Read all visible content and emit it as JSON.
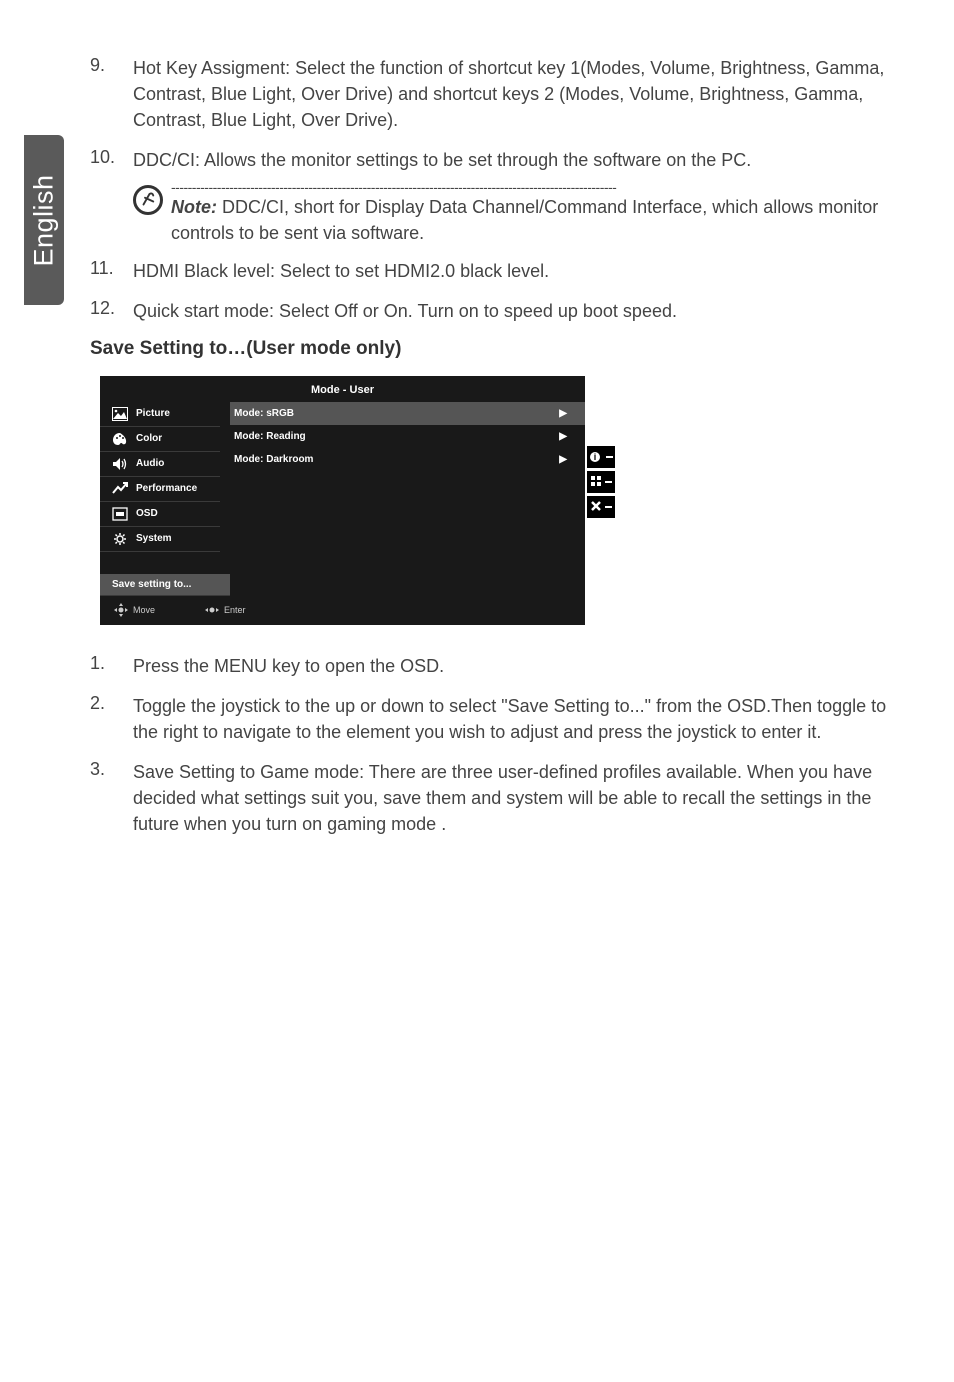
{
  "sideTab": "English",
  "items": {
    "n9": {
      "num": "9.",
      "text": "Hot Key Assigment: Select the function of shortcut key 1(Modes, Volume, Brightness, Gamma, Contrast, Blue Light, Over Drive) and shortcut keys 2 (Modes, Volume, Brightness, Gamma, Contrast, Blue Light, Over Drive)."
    },
    "n10": {
      "num": "10.",
      "text": "DDC/CI: Allows the monitor settings to be set through the software on the PC."
    },
    "note": {
      "dashes": "-----------------------------------------------------------------------------------------------------------",
      "label": "Note:",
      "body": " DDC/CI, short for Display Data Channel/Command Interface, which allows monitor controls to be sent via software."
    },
    "n11": {
      "num": "11.",
      "text": "HDMI Black level: Select to set HDMI2.0 black level."
    },
    "n12": {
      "num": "12.",
      "text": "Quick start mode: Select Off or On. Turn on to speed up boot speed."
    }
  },
  "heading": "Save Setting to…(User mode only)",
  "osd": {
    "title": "Mode - User",
    "nav": {
      "picture": "Picture",
      "color": "Color",
      "audio": "Audio",
      "performance": "Performance",
      "osd": "OSD",
      "system": "System",
      "save": "Save setting to..."
    },
    "main": {
      "r1": "Mode: sRGB",
      "r2": "Mode: Reading",
      "r3": "Mode: Darkroom"
    },
    "footer": {
      "move": "Move",
      "enter": "Enter"
    },
    "side": {
      "info": "i",
      "grid": "⠿",
      "close": "✕"
    }
  },
  "steps": {
    "s1": {
      "num": "1.",
      "text": "Press the MENU key to open the OSD."
    },
    "s2": {
      "num": "2.",
      "text": "Toggle the joystick to the up or down to select \"Save Setting to...\" from the OSD.Then toggle to the right to navigate to the element you wish to adjust and press the joystick to enter it."
    },
    "s3": {
      "num": "3.",
      "text": "Save Setting to Game mode: There are three user-defined profiles available. When you have decided what settings suit you, save them and system will be able to recall the settings in the future when you turn on gaming mode ."
    }
  }
}
